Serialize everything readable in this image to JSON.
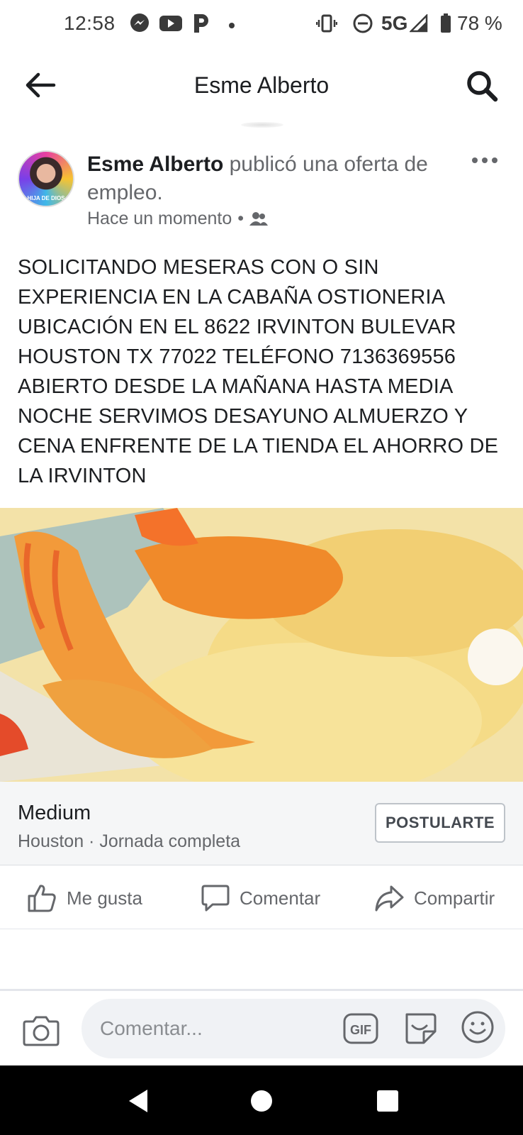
{
  "status_bar": {
    "time": "12:58",
    "network": "5G",
    "battery": "78 %",
    "icons": [
      "messenger-icon",
      "youtube-icon",
      "pandora-icon",
      "dot-icon",
      "vibrate-icon",
      "dnd-icon",
      "signal-icon",
      "battery-icon"
    ]
  },
  "header": {
    "title": "Esme Alberto",
    "back_icon": "arrow-left-icon",
    "search_icon": "search-icon"
  },
  "post": {
    "author": "Esme Alberto",
    "action": " publicó una oferta de empleo.",
    "time": "Hace un momento",
    "audience_icon": "friends-icon",
    "avatar_caption": "HIJA DE DIOS",
    "text": "SOLICITANDO MESERAS CON O SIN EXPERIENCIA EN LA CABAÑA OSTIONERIA UBICACIÓN EN EL 8622 IRVINTON BULEVAR HOUSTON TX 77022 TELÉFONO 7136369556 ABIERTO DESDE LA MAÑANA HASTA MEDIA NOCHE SERVIMOS DESAYUNO ALMUERZO Y CENA ENFRENTE DE LA TIENDA EL AHORRO DE LA IRVINTON"
  },
  "job": {
    "title": "Medium",
    "subtitle": "Houston · Jornada completa",
    "apply_label": "POSTULARTE"
  },
  "actions": {
    "like": "Me gusta",
    "comment": "Comentar",
    "share": "Compartir"
  },
  "comment_bar": {
    "placeholder": "Comentar...",
    "gif_label": "GIF"
  },
  "colors": {
    "text_primary": "#1c1e21",
    "text_secondary": "#65676b",
    "input_bg": "#f0f2f5",
    "card_bg": "#f5f6f7"
  }
}
